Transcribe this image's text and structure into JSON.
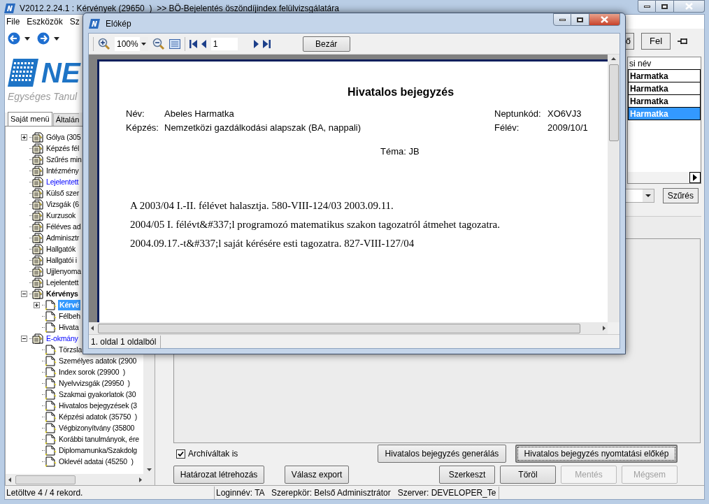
{
  "main_window": {
    "title": "V2012.2.24.1 : Kérvények (29650  )  >> BÖ-Bejelentés öszöndíjindex felülvizsgálatára",
    "menu": [
      "File",
      "Eszközök",
      "Sz"
    ],
    "logo": {
      "wordmark": "NE",
      "tagline": "Egységes Tanul"
    },
    "sidebar_tabs": [
      {
        "label": "Saját menü",
        "selected": true
      },
      {
        "label": "Általán",
        "selected": false
      }
    ],
    "tree": [
      {
        "label": "Gólya (305",
        "kind": "normal",
        "selected": false,
        "expanded": false
      },
      {
        "label": "Képzés fél",
        "kind": "normal",
        "selected": false
      },
      {
        "label": "Szűrés min",
        "kind": "normal",
        "selected": false
      },
      {
        "label": "Intézmény",
        "kind": "normal",
        "selected": false
      },
      {
        "label": "Lejelentett",
        "kind": "link",
        "selected": false
      },
      {
        "label": "Külső szer",
        "kind": "normal",
        "selected": false
      },
      {
        "label": "Vizsgák (6",
        "kind": "normal",
        "selected": false
      },
      {
        "label": "Kurzusok",
        "kind": "normal",
        "selected": false
      },
      {
        "label": "Féléves ad",
        "kind": "normal",
        "selected": false
      },
      {
        "label": "Adminisztr",
        "kind": "normal",
        "selected": false
      },
      {
        "label": "Hallgatók",
        "kind": "normal",
        "selected": false
      },
      {
        "label": "Hallgatói i",
        "kind": "normal",
        "selected": false
      },
      {
        "label": "Ujjlenyoma",
        "kind": "normal",
        "selected": false
      },
      {
        "label": "Lejelentett",
        "kind": "normal",
        "selected": false
      },
      {
        "label": "Kérvénys",
        "kind": "bold",
        "selected": false,
        "expanded": true,
        "children": [
          {
            "label": "Kérvé",
            "kind": "bold",
            "selected": true,
            "expanded": false
          },
          {
            "label": "Félbeh",
            "kind": "normal",
            "selected": false
          },
          {
            "label": "Hivata",
            "kind": "normal",
            "selected": false
          }
        ]
      },
      {
        "label": "E-okmány",
        "kind": "link",
        "selected": false,
        "expanded": true,
        "children": [
          {
            "label": "Törzsla",
            "kind": "normal",
            "selected": false
          },
          {
            "label": "Személyes adatok (2900",
            "kind": "normal",
            "selected": false
          },
          {
            "label": "Index sorok (29900  )",
            "kind": "normal",
            "selected": false
          },
          {
            "label": "Nyelvvizsgák (29950  )",
            "kind": "normal",
            "selected": false
          },
          {
            "label": "Szakmai gyakorlatok (30",
            "kind": "normal",
            "selected": false
          },
          {
            "label": "Hivatalos bejegyzések (3",
            "kind": "normal",
            "selected": false
          },
          {
            "label": "Képzési adatok (35750  )",
            "kind": "normal",
            "selected": false
          },
          {
            "label": "Végbizonyítvány (35800",
            "kind": "normal",
            "selected": false
          },
          {
            "label": "Korábbi tanulmányok, ére",
            "kind": "normal",
            "selected": false
          },
          {
            "label": "Diplomamunka/Szakdolg",
            "kind": "normal",
            "selected": false
          },
          {
            "label": "Oklevél adatai (45250  )",
            "kind": "normal",
            "selected": false
          }
        ]
      }
    ],
    "toolbar_buttons": [
      "ő",
      "Fel"
    ],
    "table": {
      "header": "si név",
      "rows": [
        {
          "cell": "Harmatka",
          "selected": false
        },
        {
          "cell": "Harmatka",
          "selected": false
        },
        {
          "cell": "Harmatka",
          "selected": false
        },
        {
          "cell": "Harmatka",
          "selected": true
        }
      ]
    },
    "filter_button": "Szűrés",
    "archived_checkbox": {
      "label": "Archíváltak is",
      "checked": true
    },
    "top_buttons": [
      {
        "label": "Hivatalos bejegyzés generálás",
        "disabled": false,
        "focused": false
      },
      {
        "label": "Hivatalos bejegyzés nyomtatási előkép",
        "disabled": false,
        "focused": true
      }
    ],
    "left_buttons": [
      {
        "label": "Határozat létrehozás",
        "disabled": false
      },
      {
        "label": "Válasz export",
        "disabled": false
      }
    ],
    "right_buttons": [
      {
        "label": "Szerkeszt",
        "disabled": false
      },
      {
        "label": "Töröl",
        "disabled": false
      },
      {
        "label": "Mentés",
        "disabled": true
      },
      {
        "label": "Mégsem",
        "disabled": true
      }
    ],
    "status_bar": [
      "Letöltve 4 / 4 rekord.",
      "Loginnév: TA   Szerepkör: Belső Adminisztrátor   Szerver: DEVELOPER_Te"
    ]
  },
  "preview_dialog": {
    "title": "Elókép",
    "zoom": "100%",
    "page": "1",
    "close_button": "Bezár",
    "document": {
      "title": "Hivatalos bejegyzés",
      "fields": [
        {
          "label": "Név:",
          "value": "Abeles Harmatka",
          "side_label": "Neptunkód:",
          "side_value": "XO6VJ3"
        },
        {
          "label": "Képzés:",
          "value": "Nemzetközi gazdálkodási alapszak (BA, nappali)",
          "side_label": "Félév:",
          "side_value": "2009/10/1"
        }
      ],
      "topic": "Téma: JB",
      "lines": [
        "A 2003/04 I.-II. félévet halasztja. 580-VIII-124/03 2003.09.11.",
        "2004/05 I. félévt&#337;l programozó matematikus szakon tagozatról átmehet tagozatra.",
        "2004.09.17.-t&#337;l saját kérésére esti tagozatra. 827-VIII-127/04"
      ]
    },
    "status": "1. oldal 1 oldalból"
  }
}
